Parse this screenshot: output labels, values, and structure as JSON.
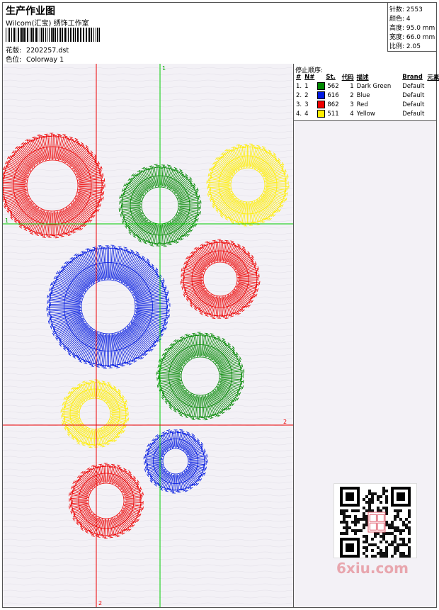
{
  "header": {
    "title": "生产作业图",
    "company": "Wilcom(汇宝) 绣饰工作室",
    "design_label": "花版:",
    "design_value": "2202257.dst",
    "colorway_label": "色位:",
    "colorway_value": "Colorway 1"
  },
  "stats": {
    "stitches": "针数: 2553",
    "colors": "颜色: 4",
    "height": "高度: 95.0 mm",
    "width": "宽度: 66.0 mm",
    "ratio": "比例: 2.05"
  },
  "stop_sequence": {
    "title": "停止顺序:",
    "headers": [
      "#",
      "N#",
      "St.",
      "代码",
      "描述",
      "Brand",
      "元素"
    ],
    "rows": [
      {
        "num": "1.",
        "n": "1",
        "stitches": "562",
        "code": "1",
        "desc": "Dark Green",
        "brand": "Default",
        "color": "#008800"
      },
      {
        "num": "2.",
        "n": "2",
        "stitches": "616",
        "code": "2",
        "desc": "Blue",
        "brand": "Default",
        "color": "#0018e0"
      },
      {
        "num": "3.",
        "n": "3",
        "stitches": "862",
        "code": "3",
        "desc": "Red",
        "brand": "Default",
        "color": "#ee0000"
      },
      {
        "num": "4.",
        "n": "4",
        "stitches": "511",
        "code": "4",
        "desc": "Yellow",
        "brand": "Default",
        "color": "#ffee00"
      }
    ]
  },
  "guides": {
    "green_label": "1",
    "red_label": "2"
  },
  "watermark": {
    "logo_text": "6xiu.com"
  },
  "colors": {
    "green": "#008800",
    "blue": "#0018e0",
    "red": "#ee0000",
    "yellow": "#ffee00"
  }
}
